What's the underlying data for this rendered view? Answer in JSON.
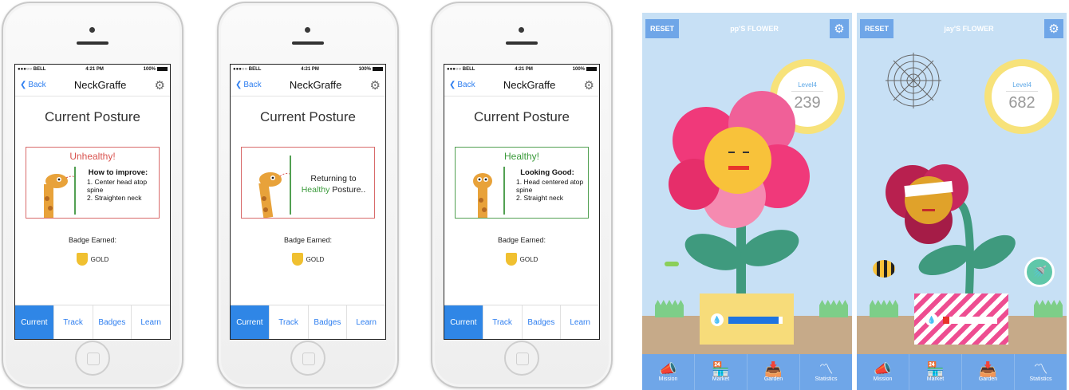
{
  "phones": [
    {
      "status": {
        "carrier": "●●●○○ BELL",
        "time": "4:21 PM",
        "battery": "100%"
      },
      "nav": {
        "back": "Back",
        "title": "NeckGraffe"
      },
      "heading": "Current Posture",
      "card": {
        "status": "Unhealthy!",
        "tip_title": "How to improve:",
        "steps": [
          "1. Center head atop spine",
          "2. Straighten neck"
        ]
      },
      "badge_label": "Badge Earned:",
      "badge": "GOLD",
      "tabs": [
        "Current",
        "Track",
        "Badges",
        "Learn"
      ]
    },
    {
      "status": {
        "carrier": "●●●○○ BELL",
        "time": "4:21 PM",
        "battery": "100%"
      },
      "nav": {
        "back": "Back",
        "title": "NeckGraffe"
      },
      "heading": "Current Posture",
      "card": {
        "returning": "Returning to",
        "healthy": "Healthy",
        "posture": " Posture.."
      },
      "badge_label": "Badge Earned:",
      "badge": "GOLD",
      "tabs": [
        "Current",
        "Track",
        "Badges",
        "Learn"
      ]
    },
    {
      "status": {
        "carrier": "●●●○○ BELL",
        "time": "4:21 PM",
        "battery": "100%"
      },
      "nav": {
        "back": "Back",
        "title": "NeckGraffe"
      },
      "heading": "Current Posture",
      "card": {
        "status": "Healthy!",
        "tip_title": "Looking Good:",
        "steps": [
          "1. Head centered atop spine",
          "2. Straight neck"
        ]
      },
      "badge_label": "Badge Earned:",
      "badge": "GOLD",
      "tabs": [
        "Current",
        "Track",
        "Badges",
        "Learn"
      ]
    }
  ],
  "flowers": [
    {
      "reset": "RESET",
      "title": "pp'S FLOWER",
      "level": "Level4",
      "points": "239",
      "water_fraction": 0.92,
      "water_color": "#1e74e0",
      "nav": [
        "Mission",
        "Market",
        "Garden",
        "Statistics"
      ]
    },
    {
      "reset": "RESET",
      "title": "jay'S FLOWER",
      "level": "Level4",
      "points": "682",
      "water_fraction": 0.12,
      "water_color": "#e8332a",
      "nav": [
        "Mission",
        "Market",
        "Garden",
        "Statistics"
      ]
    }
  ]
}
